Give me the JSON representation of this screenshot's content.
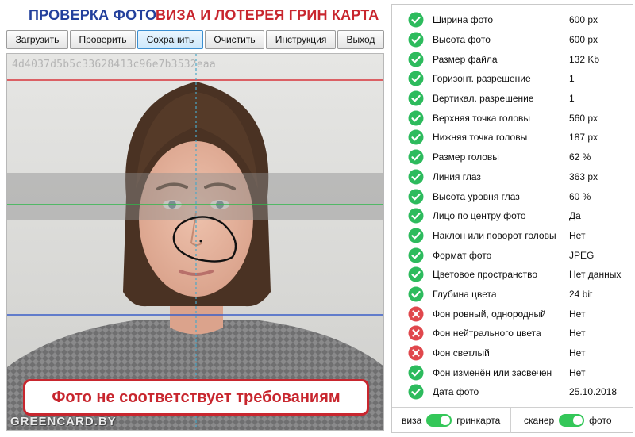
{
  "title": {
    "part1": "ПРОВЕРКА ФОТО",
    "part2": "ВИЗА И ЛОТЕРЕЯ ГРИН КАРТА"
  },
  "toolbar": {
    "load": "Загрузить",
    "check": "Проверить",
    "save": "Сохранить",
    "clear": "Очистить",
    "instructions": "Инструкция",
    "exit": "Выход"
  },
  "photo": {
    "hash": "4d4037d5b5c33628413c96e7b3532eaa",
    "verdict": "Фото не соответствует требованиям",
    "watermark": "GREENCARD.BY"
  },
  "checks": [
    {
      "label": "Ширина фото",
      "value": "600 px",
      "status": "ok"
    },
    {
      "label": "Высота фото",
      "value": "600 px",
      "status": "ok"
    },
    {
      "label": "Размер файла",
      "value": "132 Kb",
      "status": "ok"
    },
    {
      "label": "Горизонт. разрешение",
      "value": "1",
      "status": "ok"
    },
    {
      "label": "Вертикал. разрешение",
      "value": "1",
      "status": "ok"
    },
    {
      "label": "Верхняя точка головы",
      "value": "560 px",
      "status": "ok"
    },
    {
      "label": "Нижняя точка головы",
      "value": "187 px",
      "status": "ok"
    },
    {
      "label": "Размер головы",
      "value": "62 %",
      "status": "ok"
    },
    {
      "label": "Линия глаз",
      "value": "363 px",
      "status": "ok"
    },
    {
      "label": "Высота уровня глаз",
      "value": "60 %",
      "status": "ok"
    },
    {
      "label": "Лицо по центру фото",
      "value": "Да",
      "status": "ok"
    },
    {
      "label": "Наклон или поворот головы",
      "value": "Нет",
      "status": "ok"
    },
    {
      "label": "Формат фото",
      "value": "JPEG",
      "status": "ok"
    },
    {
      "label": "Цветовое пространство",
      "value": "Нет данных",
      "status": "ok"
    },
    {
      "label": "Глубина цвета",
      "value": "24 bit",
      "status": "ok"
    },
    {
      "label": "Фон ровный, однородный",
      "value": "Нет",
      "status": "fail"
    },
    {
      "label": "Фон нейтрального цвета",
      "value": "Нет",
      "status": "fail"
    },
    {
      "label": "Фон светлый",
      "value": "Нет",
      "status": "fail"
    },
    {
      "label": "Фон изменён или засвечен",
      "value": "Нет",
      "status": "ok"
    },
    {
      "label": "Дата фото",
      "value": "25.10.2018",
      "status": "ok"
    }
  ],
  "footer": {
    "toggle1_left": "виза",
    "toggle1_right": "гринкарта",
    "toggle2_left": "сканер",
    "toggle2_right": "фото"
  },
  "colors": {
    "ok": "#2dbb5d",
    "fail": "#e0474c",
    "title_blue": "#23409c",
    "title_red": "#c8262e",
    "switch_on": "#34c759"
  }
}
